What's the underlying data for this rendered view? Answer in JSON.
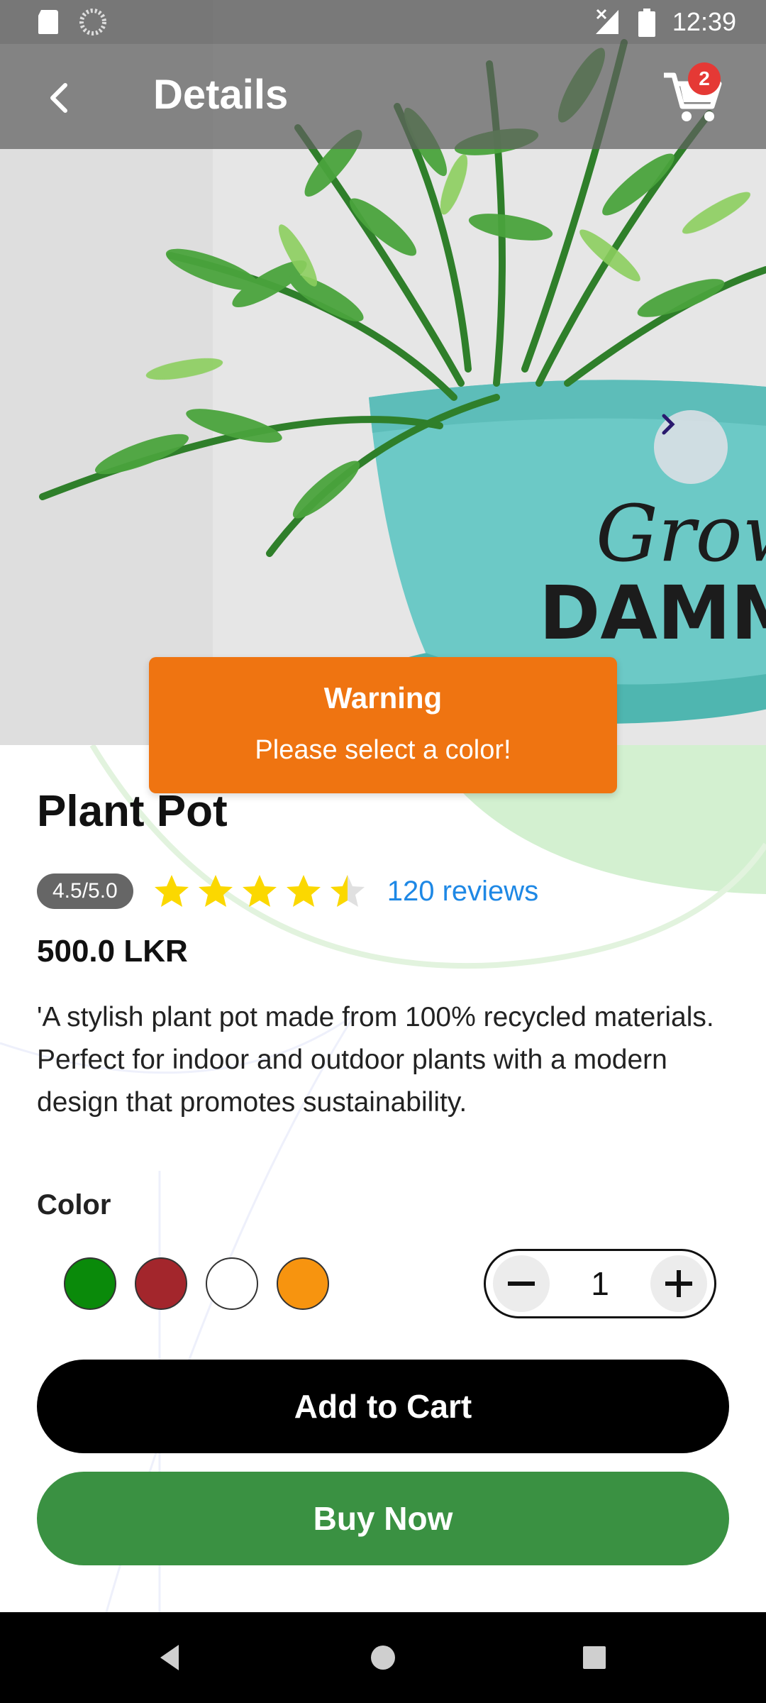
{
  "status_bar": {
    "time": "12:39",
    "icons": [
      "sd-card-icon",
      "sync-icon",
      "no-signal-icon",
      "battery-icon"
    ]
  },
  "app_bar": {
    "title": "Details",
    "back_icon": "chevron-left-icon",
    "cart_icon": "cart-icon",
    "cart_badge": "2"
  },
  "hero_image": {
    "description": "product-photo",
    "next_icon": "chevron-right-icon"
  },
  "toast": {
    "title": "Warning",
    "message": "Please select a color!",
    "color": "#ef7411"
  },
  "product": {
    "name": "Plant Pot",
    "rating_label": "4.5/5.0",
    "rating_value": 4.5,
    "rating_max": 5,
    "reviews": "120 reviews",
    "price": "500.0 LKR",
    "description": "'A stylish plant pot made from 100% recycled materials. Perfect for indoor and outdoor plants with a modern design that promotes sustainability.",
    "color_label": "Color",
    "colors": [
      "#0a8a0a",
      "#a3262c",
      "#ffffff",
      "#f7940f"
    ],
    "quantity": "1"
  },
  "actions": {
    "add_to_cart": "Add to Cart",
    "buy_now": "Buy Now"
  },
  "theme": {
    "accent_blue": "#1e88e5",
    "buy_green": "#3a9142",
    "badge_red": "#e53935"
  },
  "nav_bar": {
    "icons": [
      "back-triangle-icon",
      "home-circle-icon",
      "recents-square-icon"
    ]
  }
}
